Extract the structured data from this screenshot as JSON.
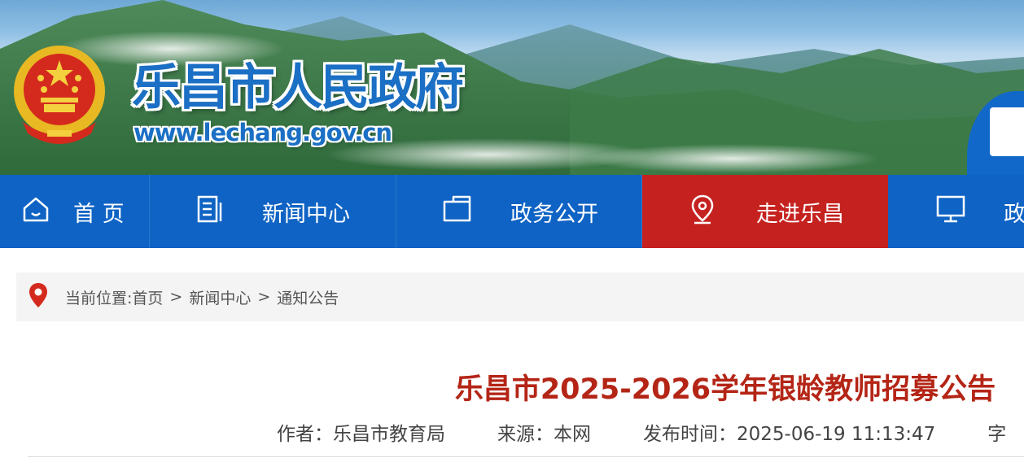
{
  "header": {
    "site_title": "乐昌市人民政府",
    "site_url": "www.lechang.gov.cn",
    "brand_color": "#1b6fc4"
  },
  "nav": {
    "items": [
      {
        "label": "首 页",
        "icon": "home-icon"
      },
      {
        "label": "新闻中心",
        "icon": "document-icon"
      },
      {
        "label": "政务公开",
        "icon": "folder-icon"
      },
      {
        "label": "走进乐昌",
        "icon": "location-pin-icon",
        "active": true
      },
      {
        "label": "政",
        "icon": "monitor-icon"
      }
    ],
    "colors": {
      "background": "#0f63c4",
      "active": "#c5221f"
    }
  },
  "breadcrumb": {
    "prefix": "当前位置:",
    "items": [
      "首页",
      "新闻中心",
      "通知公告"
    ],
    "separator": ">"
  },
  "article": {
    "title": "乐昌市2025-2026学年银龄教师招募公告",
    "title_color": "#b42516",
    "meta": {
      "author": "作者：乐昌市教育局",
      "source": "来源：本网",
      "published": "发布时间：2025-06-19 11:13:47",
      "font_size_label": "字"
    }
  }
}
